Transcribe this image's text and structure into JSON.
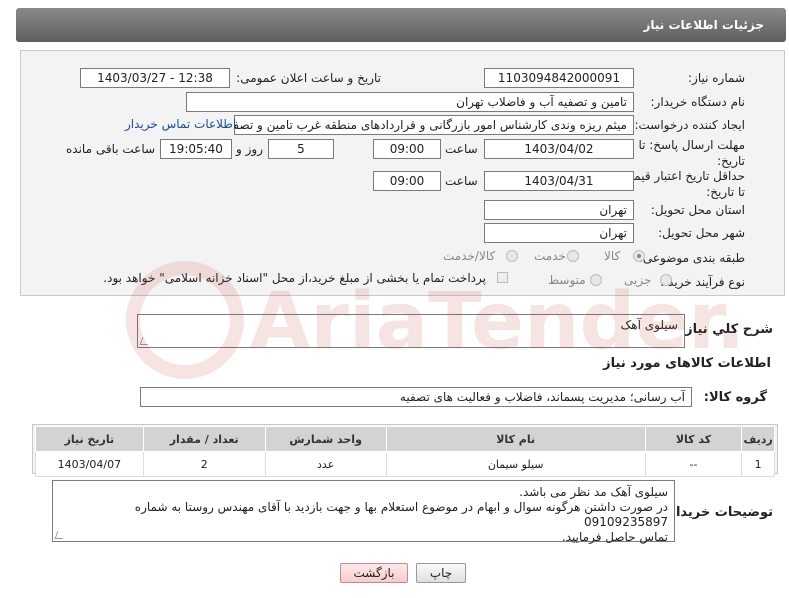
{
  "header": {
    "title": "جزئیات اطلاعات نیاز"
  },
  "form": {
    "need_number": {
      "label": "شماره نیاز:",
      "value": "1103094842000091"
    },
    "announce_datetime": {
      "label": "تاریخ و ساعت اعلان عمومی:",
      "value": "1403/03/27 - 12:38"
    },
    "buyer_org": {
      "label": "نام دستگاه خریدار:",
      "value": "تامین و تصفیه آب و فاضلاب تهران"
    },
    "requester": {
      "label": "ایجاد کننده درخواست:",
      "value": "میثم ریزه وندی کارشناس امور بازرگانی و قراردادهای منطقه غرب تامین و تصفیه",
      "contact_link": "اطلاعات تماس خریدار"
    },
    "reply_deadline": {
      "label": "مهلت ارسال پاسخ: تا تاریخ:",
      "date": "1403/04/02",
      "time_label": "ساعت",
      "time": "09:00",
      "days": "5",
      "days_label": "روز و",
      "remaining_time": "19:05:40",
      "remaining_label": "ساعت باقی مانده"
    },
    "price_validity": {
      "label": "حداقل تاریخ اعتبار قیمت: تا تاریخ:",
      "date": "1403/04/31",
      "time_label": "ساعت",
      "time": "09:00"
    },
    "delivery_province": {
      "label": "استان محل تحویل:",
      "value": "تهران"
    },
    "delivery_city": {
      "label": "شهر محل تحویل:",
      "value": "تهران"
    },
    "category": {
      "label": "طبقه بندی موضوعی:",
      "options": [
        "کالا",
        "خدمت",
        "کالا/خدمت"
      ],
      "selected": "کالا"
    },
    "purchase_type": {
      "label": "نوع فرآیند خرید :",
      "options": [
        "جزیی",
        "متوسط"
      ],
      "selected": "",
      "payment_note": "پرداخت تمام یا بخشی از مبلغ خرید،از محل \"اسناد خزانه اسلامی\" خواهد بود."
    }
  },
  "summary": {
    "label": "شرح کلي نياز:",
    "value": "سیلوی آهک"
  },
  "goods_info_title": "اطلاعات کالاهای مورد نیاز",
  "goods_group": {
    "label": "گروه کالا:",
    "value": "آب رسانی؛ مدیریت پسماند، فاضلاب و فعالیت های تصفیه"
  },
  "table": {
    "columns": [
      "ردیف",
      "کد کالا",
      "نام کالا",
      "واحد شمارش",
      "تعداد / مقدار",
      "تاریخ نیاز"
    ],
    "rows": [
      {
        "row": "1",
        "code": "--",
        "name": "سیلو سیمان",
        "unit": "عدد",
        "qty": "2",
        "date": "1403/04/07"
      }
    ]
  },
  "buyer_notes": {
    "label": "توضیحات خریدار:",
    "lines": [
      "سیلوی آهک مد نظر می باشد.",
      "در صورت داشتن هرگونه سوال و ابهام در موضوع استعلام بها و جهت بازدید با آقای مهندس روستا  به شماره 09109235897",
      "تماس حاصل فرمایید."
    ]
  },
  "buttons": {
    "print": "چاپ",
    "back": "بازگشت"
  },
  "watermark": "AriaTender.neT"
}
